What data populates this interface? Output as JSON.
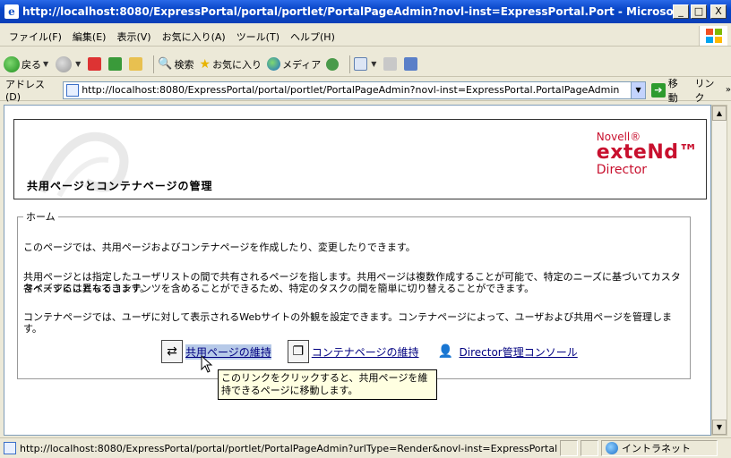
{
  "window": {
    "title": "http://localhost:8080/ExpressPortal/portal/portlet/PortalPageAdmin?novl-inst=ExpressPortal.Port - Microsoft Internet Explorer",
    "minimize": "_",
    "maximize": "□",
    "close": "X"
  },
  "menubar": {
    "items": [
      "ファイル(F)",
      "編集(E)",
      "表示(V)",
      "お気に入り(A)",
      "ツール(T)",
      "ヘルプ(H)"
    ]
  },
  "toolbar": {
    "back": "戻る",
    "search": "検索",
    "favorites": "お気に入り",
    "media": "メディア"
  },
  "addressbar": {
    "label": "アドレス(D)",
    "url": "http://localhost:8080/ExpressPortal/portal/portlet/PortalPageAdmin?novl-inst=ExpressPortal.PortalPageAdmin",
    "go": "移動",
    "links": "リンク"
  },
  "header": {
    "title": "共用ページとコンテナページの管理",
    "brand_novell": "Novell®",
    "brand_extend": "exteNd™",
    "brand_director": "Director"
  },
  "home": {
    "legend": "ホーム",
    "p1": "このページでは、共用ページおよびコンテナページを作成したり、変更したりできます。",
    "p2a": "共用ページとは指定したユーザリストの間で共有されるページを指します。共用ページは複数作成することが可能で、特定のニーズに基づいてカスタマイズすることもできます。",
    "p2b": "各ページには異なるコンテンツを含めることができるため、特定のタスクの間を簡単に切り替えることができます。",
    "p3": "コンテナページでは、ユーザに対して表示されるWebサイトの外観を設定できます。コンテナページによって、ユーザおよび共用ページを管理します。",
    "links": [
      {
        "label": "共用ページの維持"
      },
      {
        "label": "コンテナページの維持"
      },
      {
        "label": "Director管理コンソール"
      }
    ],
    "tooltip": "このリンクをクリックすると、共用ページを維持できるページに移動します。"
  },
  "statusbar": {
    "text": "http://localhost:8080/ExpressPortal/portal/portlet/PortalPageAdmin?urlType=Render&novl-inst=ExpressPortal.PortalPageAdmin&wsrp-",
    "zone": "イントラネット"
  }
}
